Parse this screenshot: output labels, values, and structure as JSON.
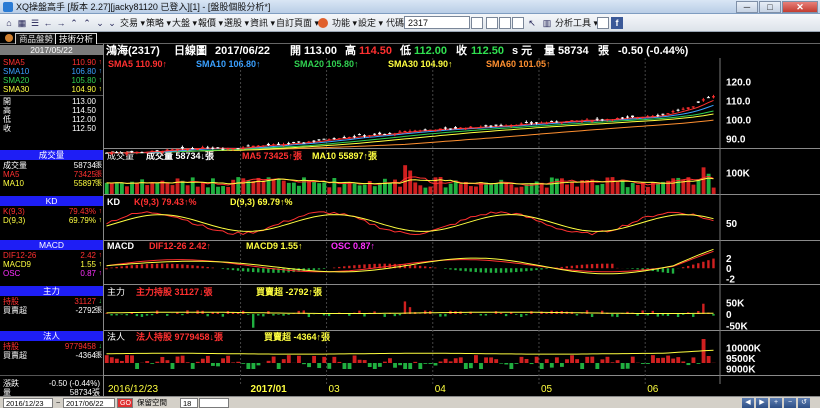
{
  "window": {
    "title": "XQ操盤高手 [版本 2.27][jacky81120 已登入][1] - [盤股個股分析*]",
    "buttons": {
      "minimize": "─",
      "maximize": "□",
      "close": "✕"
    }
  },
  "toolbar": {
    "menu_trade": "交易 ▾",
    "menu_strategy": "策略 ▾",
    "menu_market": "大盤 ▾",
    "menu_report": "報價 ▾",
    "menu_select": "選股 ▾",
    "menu_info": "資訊 ▾",
    "menu_custom": "自訂頁面 ▾",
    "menu_func": "功能 ▾",
    "menu_settings": "設定 ▾",
    "code_label": "代碼",
    "code_value": "2317",
    "analysis_tool": "分析工具 ▾",
    "fb": "f"
  },
  "tabs": {
    "tab1": "商品盤勢",
    "tab2": "技術分析"
  },
  "sidebar": {
    "date": "2017/05/22",
    "ma_rows": [
      {
        "label": "SMA5",
        "value": "110.90",
        "arrow": "↑",
        "color": "#ff3030"
      },
      {
        "label": "SMA10",
        "value": "106.80",
        "arrow": "↑",
        "color": "#3aa0ff"
      },
      {
        "label": "SMA20",
        "value": "105.80",
        "arrow": "↑",
        "color": "#30d050"
      },
      {
        "label": "SMA30",
        "value": "104.90",
        "arrow": "↑",
        "color": "#ffff40"
      }
    ],
    "price_rows": [
      {
        "label": "開",
        "value": "113.00"
      },
      {
        "label": "高",
        "value": "114.50"
      },
      {
        "label": "低",
        "value": "112.00"
      },
      {
        "label": "收",
        "value": "112.50"
      }
    ],
    "volume": {
      "header": "成交量",
      "rows": [
        {
          "label": "成交量",
          "value": "58734",
          "arrow": "張",
          "color": "#ffffff"
        },
        {
          "label": "MA5",
          "value": "73425",
          "arrow": "張",
          "color": "#ff3030"
        },
        {
          "label": "MA10",
          "value": "55897",
          "arrow": "張",
          "color": "#ffff40"
        }
      ]
    },
    "kd": {
      "header": "KD",
      "rows": [
        {
          "label": "K(9,3)",
          "value": "79.43%",
          "arrow": "↑",
          "color": "#ff3030"
        },
        {
          "label": "D(9,3)",
          "value": "69.79%",
          "arrow": "↑",
          "color": "#ffff40"
        }
      ]
    },
    "macd": {
      "header": "MACD",
      "rows": [
        {
          "label": "DIF12-26",
          "value": "2.42",
          "arrow": "↑",
          "color": "#ff3030"
        },
        {
          "label": "MACD9",
          "value": "1.55",
          "arrow": "↑",
          "color": "#ffff40"
        },
        {
          "label": "OSC",
          "value": "0.87",
          "arrow": "↑",
          "color": "#ff30ff"
        }
      ]
    },
    "main_force": {
      "header": "主力",
      "rows": [
        {
          "label": "持股",
          "value": "31127",
          "arrow": "↓",
          "color": "#ff3030"
        },
        {
          "label": "買賣超",
          "value": "-2792",
          "arrow": "張",
          "color": "#ffffff"
        }
      ]
    },
    "institutional": {
      "header": "法人",
      "rows": [
        {
          "label": "持股",
          "value": "9779458",
          "arrow": "↓",
          "color": "#ff3030"
        },
        {
          "label": "買賣超",
          "value": "-4364",
          "arrow": "張",
          "color": "#ffffff"
        }
      ]
    },
    "change_label": "漲跌",
    "change_value": "-0.50 (-0.44%)",
    "volume_label": "量",
    "volume_value": "58734張"
  },
  "price_header": {
    "name": "鴻海(2317)",
    "period": "日線圖",
    "date": "2017/06/22",
    "open_label": "開",
    "open": "113.00",
    "high_label": "高",
    "high": "114.50",
    "low_label": "低",
    "low": "112.00",
    "close_label": "收",
    "close": "112.50",
    "unit": "s 元",
    "vol_label": "量",
    "vol": "58734",
    "vol_unit": "張",
    "change": "-0.50 (-0.44%)"
  },
  "ma_legend": [
    {
      "text": "SMA5 110.90↑",
      "color": "#ff3030"
    },
    {
      "text": "SMA10 106.80↑",
      "color": "#3aa0ff"
    },
    {
      "text": "SMA20 105.80↑",
      "color": "#30d050"
    },
    {
      "text": "SMA30 104.90↑",
      "color": "#ffff40"
    },
    {
      "text": "SMA60 101.05↑",
      "color": "#ff9030"
    }
  ],
  "vol_legend": [
    {
      "text": "成交量",
      "color": "#ffffff"
    },
    {
      "text": "成交量 58734↓張",
      "color": "#ffffff"
    },
    {
      "text": "MA5 73425↑張",
      "color": "#ff3030"
    },
    {
      "text": "MA10 55897↑張",
      "color": "#ffff40"
    }
  ],
  "kd_legend": [
    {
      "text": "KD",
      "color": "#ffffff"
    },
    {
      "text": "K(9,3) 79.43↑%",
      "color": "#ff3030"
    },
    {
      "text": "D(9,3) 69.79↑%",
      "color": "#ffff40"
    }
  ],
  "macd_legend": [
    {
      "text": "MACD",
      "color": "#ffffff"
    },
    {
      "text": "DIF12-26 2.42↑",
      "color": "#ff3030"
    },
    {
      "text": "MACD9 1.55↑",
      "color": "#ffff40"
    },
    {
      "text": "OSC 0.87↑",
      "color": "#ff30ff"
    }
  ],
  "mf_legend": [
    {
      "text": "主力",
      "color": "#ffffff"
    },
    {
      "text": "主力持股 31127↓張",
      "color": "#ff3030"
    },
    {
      "text": "買賣超 -2792↑張",
      "color": "#ffff40"
    }
  ],
  "inst_legend": [
    {
      "text": "法人",
      "color": "#ffffff"
    },
    {
      "text": "法人持股 9779458↓張",
      "color": "#ff3030"
    },
    {
      "text": "買賣超 -4364↑張",
      "color": "#ffff40"
    }
  ],
  "chart_data": {
    "type": "candlestick",
    "x_start": "2016/12/23",
    "x_end": "2017/06/22",
    "month_ticks": [
      "2016/12/23",
      "2017/01",
      "03",
      "04",
      "05",
      "06"
    ],
    "panels": [
      {
        "name": "price",
        "y_ticks": [
          "120.0",
          "110.0",
          "100.0",
          "90.0"
        ],
        "ylim": [
          84,
          126
        ]
      },
      {
        "name": "volume",
        "y_ticks": [
          "100K"
        ],
        "ylim": [
          0,
          150000
        ]
      },
      {
        "name": "kd",
        "y_ticks": [
          "50"
        ],
        "ylim": [
          0,
          100
        ]
      },
      {
        "name": "macd",
        "y_ticks": [
          "2",
          "0",
          "-2"
        ],
        "ylim": [
          -3.5,
          3.2
        ]
      },
      {
        "name": "main_force",
        "y_ticks": [
          "50K",
          "0",
          "-50K"
        ],
        "ylim": [
          -70000,
          70000
        ]
      },
      {
        "name": "institutional",
        "y_ticks": [
          "10000K",
          "9500K",
          "9000K"
        ],
        "ylim": [
          8800000,
          10200000
        ]
      }
    ],
    "price_close_approx": [
      [
        0,
        82.5
      ],
      [
        5,
        82.8
      ],
      [
        10,
        83.4
      ],
      [
        15,
        84.5
      ],
      [
        20,
        85.2
      ],
      [
        25,
        84.9
      ],
      [
        30,
        86.2
      ],
      [
        35,
        87.0
      ],
      [
        40,
        88.4
      ],
      [
        45,
        90.2
      ],
      [
        50,
        91.5
      ],
      [
        55,
        92.3
      ],
      [
        60,
        94.0
      ],
      [
        65,
        94.8
      ],
      [
        70,
        95.6
      ],
      [
        75,
        96.4
      ],
      [
        80,
        97.3
      ],
      [
        85,
        98.2
      ],
      [
        90,
        99.0
      ],
      [
        95,
        99.6
      ],
      [
        100,
        100.4
      ],
      [
        105,
        101.2
      ],
      [
        110,
        102.8
      ],
      [
        113,
        105.0
      ],
      [
        116,
        106.5
      ],
      [
        118,
        110.9
      ],
      [
        120,
        112.5
      ]
    ]
  },
  "status": {
    "date_from": "2016/12/23",
    "tilde": "~",
    "date_to": "2017/06/22",
    "label": "保留空間",
    "value": "18",
    "go": "GO"
  }
}
